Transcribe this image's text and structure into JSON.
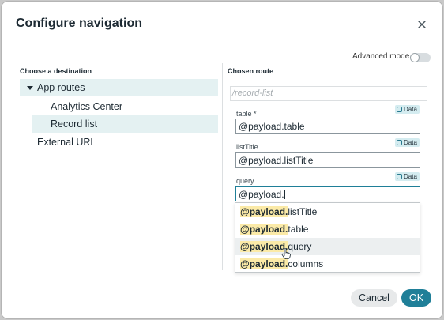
{
  "dialog": {
    "title": "Configure navigation",
    "close_icon": "close-icon"
  },
  "advanced_mode": {
    "label": "Advanced mode",
    "enabled": false
  },
  "destination": {
    "heading": "Choose a destination",
    "tree": [
      {
        "label": "App routes",
        "expanded": true,
        "selected": true
      },
      {
        "label": "Analytics Center"
      },
      {
        "label": "Record list",
        "selected": true
      },
      {
        "label": "External URL"
      }
    ]
  },
  "route": {
    "heading": "Chosen route",
    "path_placeholder": "/record-list",
    "data_badge": "Data",
    "fields": [
      {
        "label": "table *",
        "value": "@payload.table"
      },
      {
        "label": "listTitle",
        "value": "@payload.listTitle"
      },
      {
        "label": "query",
        "value": "@payload."
      }
    ]
  },
  "autocomplete": {
    "items": [
      {
        "match": "@payload.",
        "rest": "listTitle"
      },
      {
        "match": "@payload.",
        "rest": "table"
      },
      {
        "match": "@payload.",
        "rest": "query"
      },
      {
        "match": "@payload.",
        "rest": "columns"
      }
    ],
    "hovered_index": 2
  },
  "footer": {
    "cancel_label": "Cancel",
    "ok_label": "OK"
  },
  "colors": {
    "accent": "#1f7f98",
    "selection": "#e4f1f2",
    "match_highlight": "#fbeaa7"
  }
}
